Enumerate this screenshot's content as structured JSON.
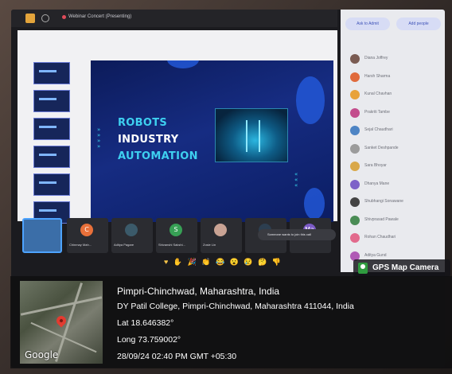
{
  "meeting": {
    "title": "Webinar Concert (Presenting)"
  },
  "slide": {
    "title_line1": "ROBOTS",
    "title_line2": "INDUSTRY",
    "title_line3": "AUTOMATION"
  },
  "participants_tiles": [
    {
      "name": "",
      "initial": ""
    },
    {
      "name": "Chinmay Mah...",
      "initial": "C",
      "color": "#e8703a"
    },
    {
      "name": "Aditya Pagare",
      "initial": "",
      "color": "#3b5a6a"
    },
    {
      "name": "Shivanshi Sakshi...",
      "initial": "S",
      "color": "#37a055"
    },
    {
      "name": "Zosie Lin",
      "initial": "",
      "color": "#c9a394"
    },
    {
      "name": "",
      "initial": "",
      "color": "#2c3e50"
    },
    {
      "name": "",
      "initial": "Ma",
      "color": "#7b5ac6"
    }
  ],
  "join_note": "Someone wants to join this call",
  "sidebar": {
    "button_left": "Ask to Admit",
    "button_right": "Add people",
    "people": [
      {
        "name": "Diana Joffrey",
        "color": "#7a5b52"
      },
      {
        "name": "Harsh Sharma",
        "color": "#e06a3c"
      },
      {
        "name": "Kunal Chavhan",
        "color": "#e8a23a"
      },
      {
        "name": "Prakriti Tambe",
        "color": "#c34d8c"
      },
      {
        "name": "Sejal Chaudhari",
        "color": "#4d84c4"
      },
      {
        "name": "Sanket Deshpande",
        "color": "#9b9b9b"
      },
      {
        "name": "Sara Bhoyar",
        "color": "#d9a84a"
      },
      {
        "name": "Dhanya Mane",
        "color": "#7d62c8"
      },
      {
        "name": "Shubhangi Sonawane",
        "color": "#444444"
      },
      {
        "name": "Shivprasad Pawale",
        "color": "#4a8c55"
      },
      {
        "name": "Rohan Chaudhari",
        "color": "#e26a8c"
      },
      {
        "name": "Aditya Gund",
        "color": "#b05ab5"
      }
    ]
  },
  "reactions": "♥ ✋ 🎉 👏 😂 😮 😢 🤔 👎",
  "gps_tag": "GPS Map Camera",
  "location": {
    "city": "Pimpri-Chinchwad, Maharashtra, India",
    "address": "DY Patil College, Pimpri-Chinchwad, Maharashtra 411044, India",
    "lat": "Lat 18.646382°",
    "long": "Long 73.759002°",
    "timestamp": "28/09/24 02:40 PM GMT +05:30",
    "map_brand": "Google"
  }
}
